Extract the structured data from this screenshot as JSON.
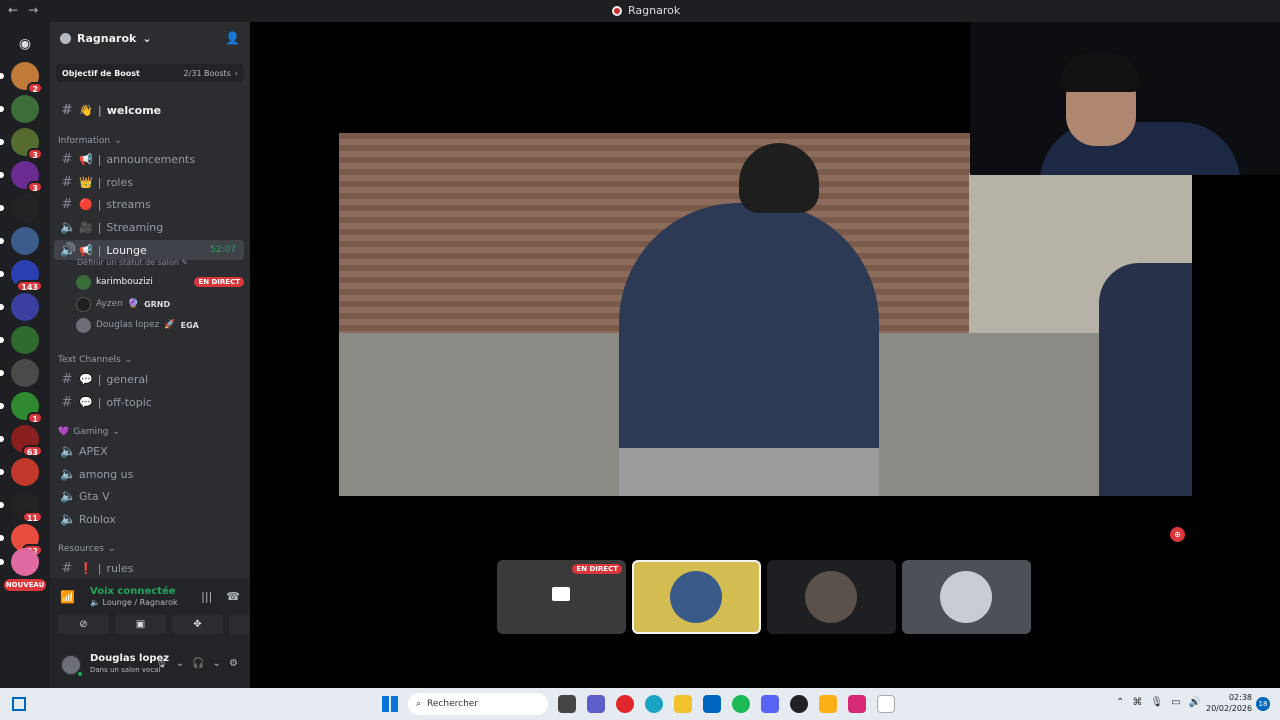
{
  "window": {
    "title": "Ragnarok",
    "nav_back": "←",
    "nav_forward": "→"
  },
  "rail": {
    "servers": [
      {
        "badge": "2",
        "color": "#c07a3a"
      },
      {
        "badge": "",
        "color": "#3c6e3a"
      },
      {
        "badge": "3",
        "color": "#556b2f"
      },
      {
        "badge": "3",
        "color": "#6a2c91"
      },
      {
        "badge": "",
        "color": "#222222"
      },
      {
        "badge": "",
        "color": "#3b5b8a"
      },
      {
        "badge": "143",
        "color": "#2a3fb0"
      },
      {
        "badge": "",
        "color": "#3a3fa0"
      },
      {
        "badge": "",
        "color": "#2f6a2f"
      },
      {
        "badge": "",
        "color": "#4a4a4a"
      },
      {
        "badge": "1",
        "color": "#2f8a2f"
      },
      {
        "badge": "63",
        "color": "#8a1f1f"
      },
      {
        "badge": "",
        "color": "#c0392b"
      },
      {
        "badge": "11",
        "color": "#222222"
      },
      {
        "badge": "22",
        "color": "#e74c3c"
      },
      {
        "badge": "",
        "color": "#e06aa0"
      }
    ],
    "new_label": "NOUVEAU"
  },
  "sidebar": {
    "guild_name": "Ragnarok",
    "boost": {
      "goal": "Objectif de Boost",
      "count": "2/31 Boosts"
    },
    "welcome": {
      "icon": "👋",
      "name": "welcome"
    },
    "categories": {
      "information": "Information",
      "text_channels": "Text Channels",
      "gaming": "Gaming",
      "resources": "Resources"
    },
    "info_channels": [
      {
        "icon": "📢",
        "name": "announcements"
      },
      {
        "icon": "👑",
        "name": "roles"
      },
      {
        "icon": "🔴",
        "name": "streams"
      },
      {
        "icon": "🎥",
        "name": "Streaming"
      }
    ],
    "lounge": {
      "name": "Lounge",
      "timer": "52:07",
      "status": "Définir un statut de salon"
    },
    "members": [
      {
        "name": "karimbouzizi",
        "tag": "",
        "live": "EN DIRECT"
      },
      {
        "name": "Ayzen",
        "tag": "GRND",
        "live": ""
      },
      {
        "name": "Douglas lopez",
        "tag": "EGA",
        "live": ""
      }
    ],
    "text_channels": [
      {
        "icon": "💬",
        "name": "general"
      },
      {
        "icon": "💬",
        "name": "off-topic"
      }
    ],
    "gaming_channels": [
      "APEX",
      "among us",
      "Gta V",
      "Roblox"
    ],
    "resource_channels": [
      {
        "icon": "❗",
        "name": "rules"
      }
    ]
  },
  "voice": {
    "connected": "Voix connectée",
    "location": "Lounge / Ragnarok"
  },
  "user": {
    "name": "Douglas lopez",
    "status": "Dans un salon vocal"
  },
  "stage": {
    "tile_live": "EN DIRECT"
  },
  "taskbar": {
    "search_placeholder": "Rechercher",
    "time": "02:38",
    "date": "20/02/2026",
    "notif_count": "18"
  }
}
